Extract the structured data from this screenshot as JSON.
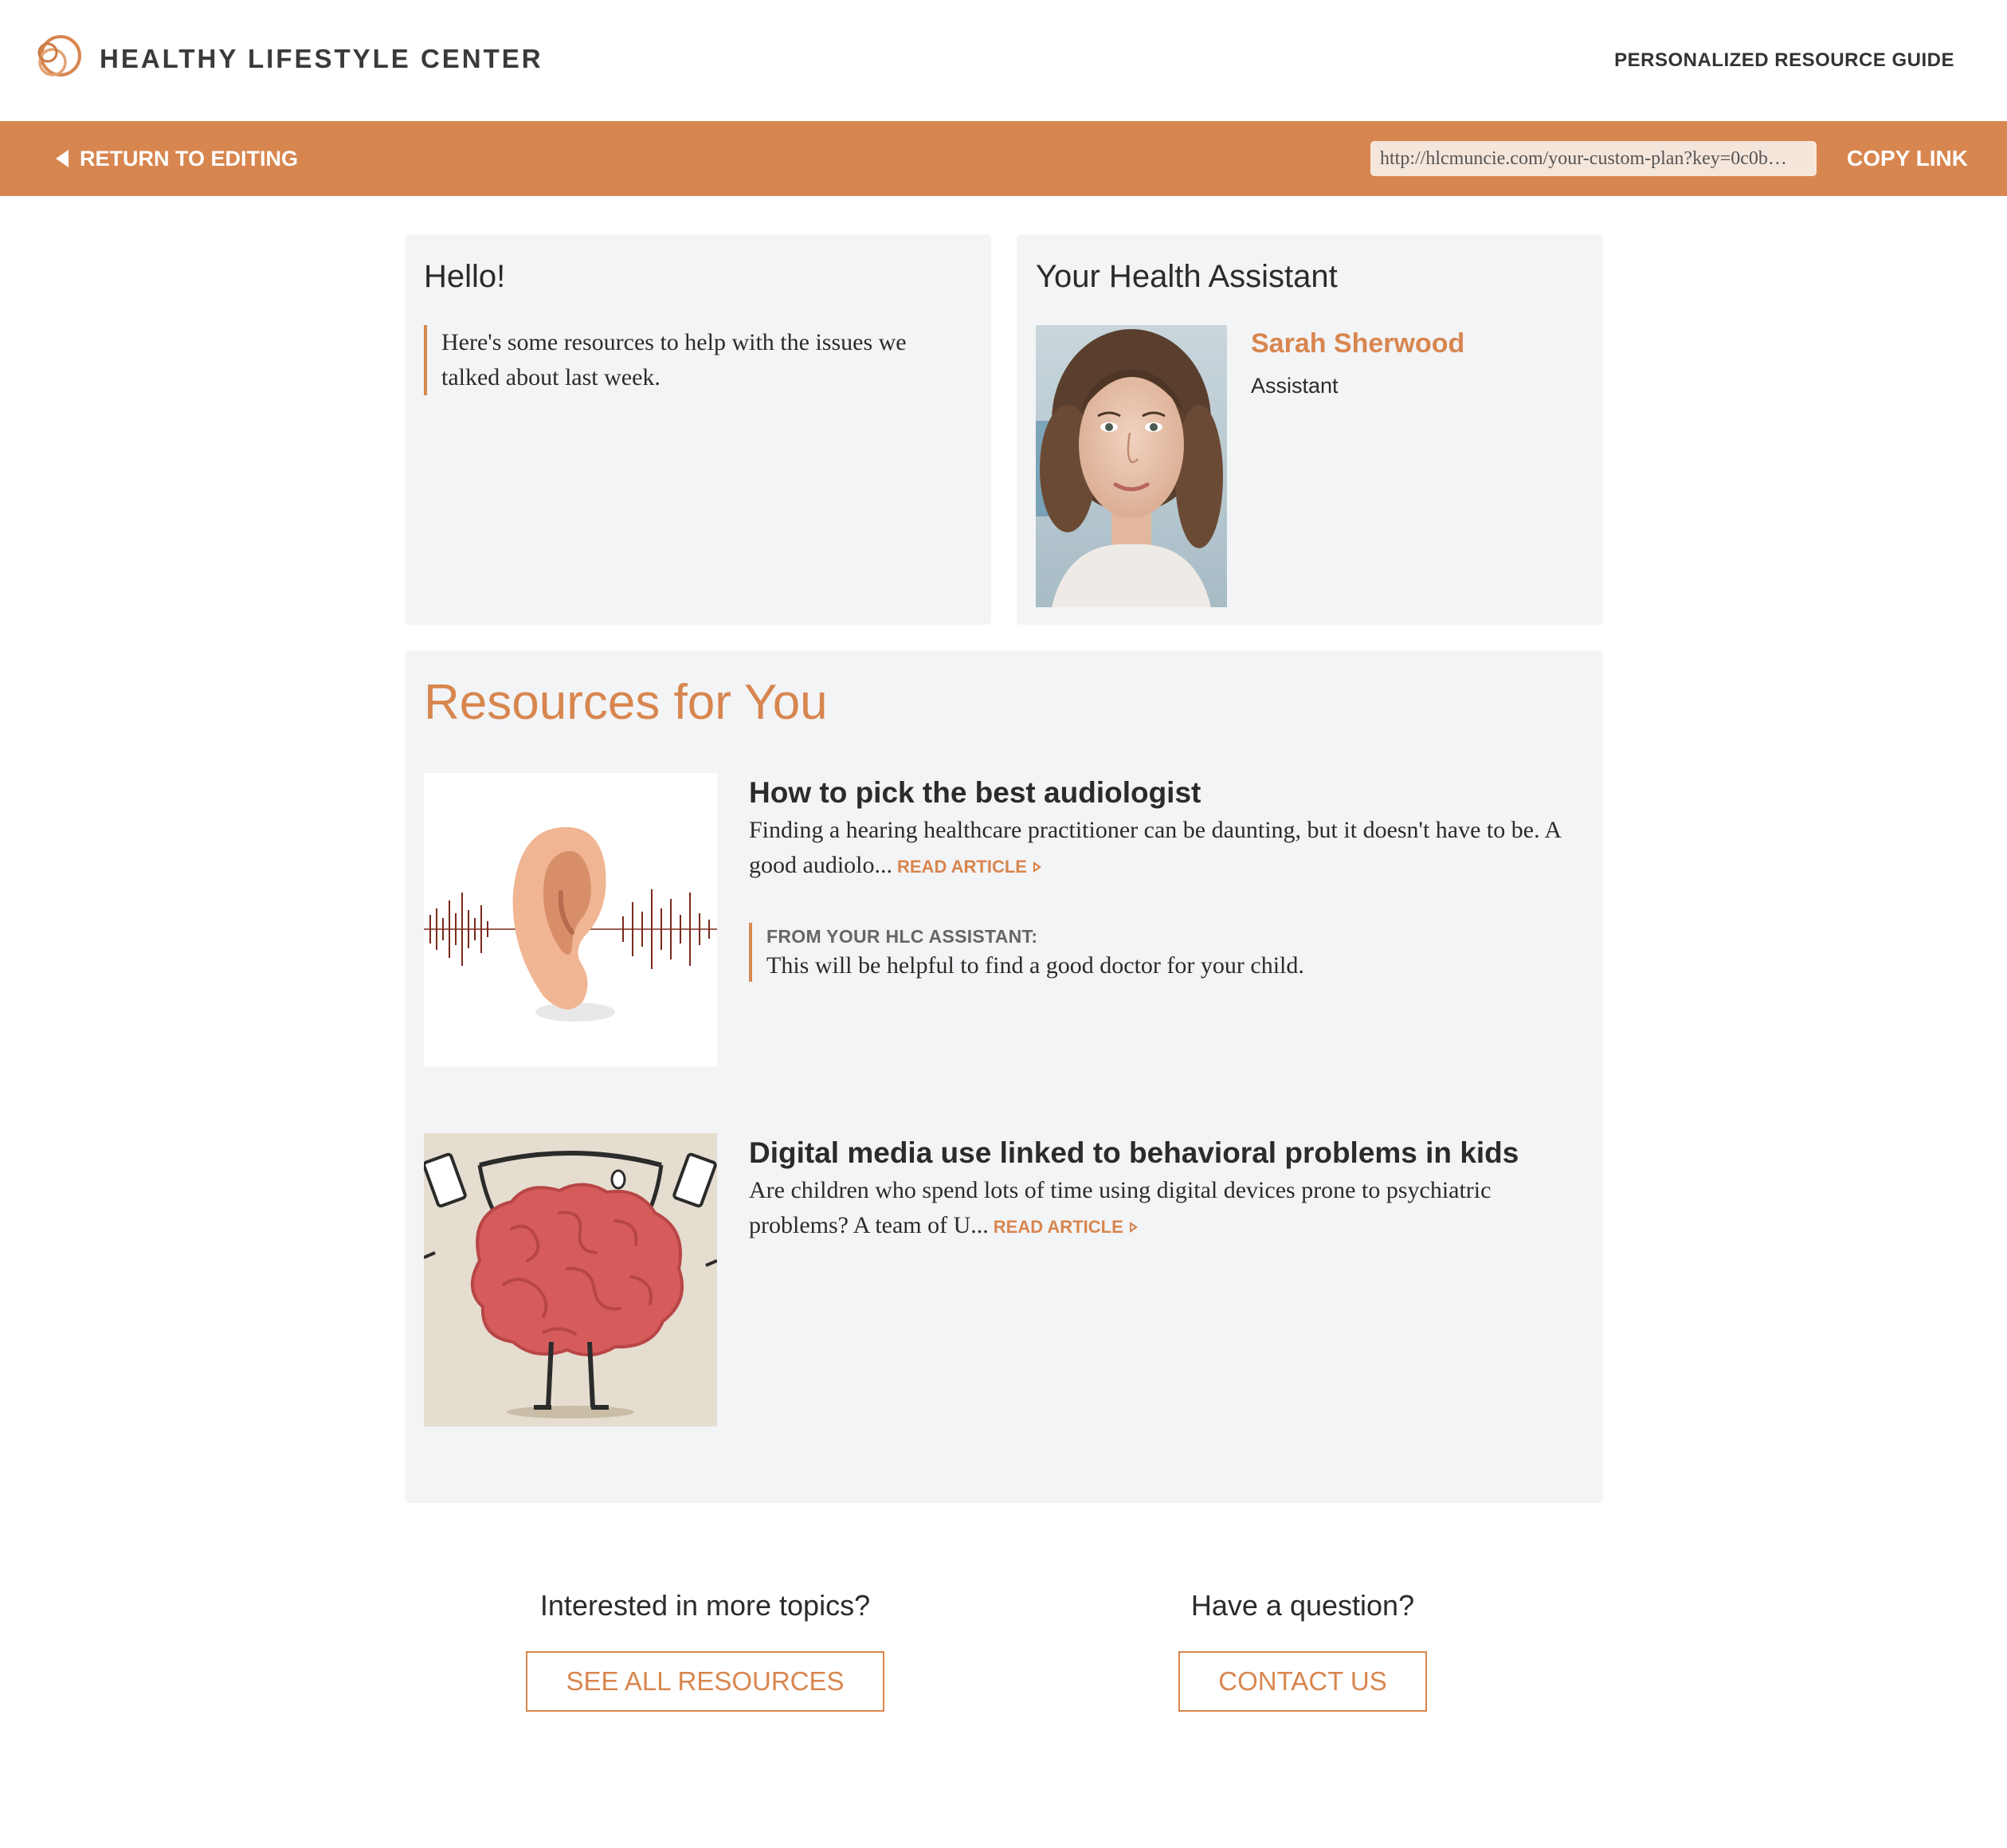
{
  "header": {
    "brand": "HEALTHY LIFESTYLE CENTER",
    "guide_label": "PERSONALIZED RESOURCE GUIDE",
    "logo_icon": "interlocking-circles-logo"
  },
  "toolbar": {
    "return_label": "RETURN TO EDITING",
    "share_link": "http://hlcmuncie.com/your-custom-plan?key=0c0b…",
    "copy_label": "COPY LINK"
  },
  "greeting": {
    "title": "Hello!",
    "message": "Here's some resources to help with the issues we talked about last week."
  },
  "assistant": {
    "title": "Your Health Assistant",
    "name": "Sarah Sherwood",
    "role": "Assistant",
    "photo_icon": "assistant-portrait"
  },
  "resources": {
    "title": "Resources for You",
    "items": [
      {
        "title": "How to pick the best audiologist",
        "excerpt": "Finding a hearing healthcare practitioner can be daunting, but it doesn't have to be. A good audiolo...",
        "read_label": "READ ARTICLE",
        "note_label": "FROM YOUR HLC ASSISTANT:",
        "note_text": "This will be helpful to find a good doctor for your child.",
        "image_icon": "ear-soundwave-image"
      },
      {
        "title": "Digital media use linked to behavioral problems in kids",
        "excerpt": "Are children who spend lots of time using digital devices prone to psychiatric problems? A team of U...",
        "read_label": "READ ARTICLE",
        "image_icon": "brain-lifting-weights-image"
      }
    ]
  },
  "footer": {
    "topics_question": "Interested in more topics?",
    "topics_button": "SEE ALL RESOURCES",
    "contact_question": "Have a question?",
    "contact_button": "CONTACT US"
  },
  "colors": {
    "accent": "#d8864f",
    "card_bg": "#f3f4f6",
    "text": "#2b2b2b"
  }
}
